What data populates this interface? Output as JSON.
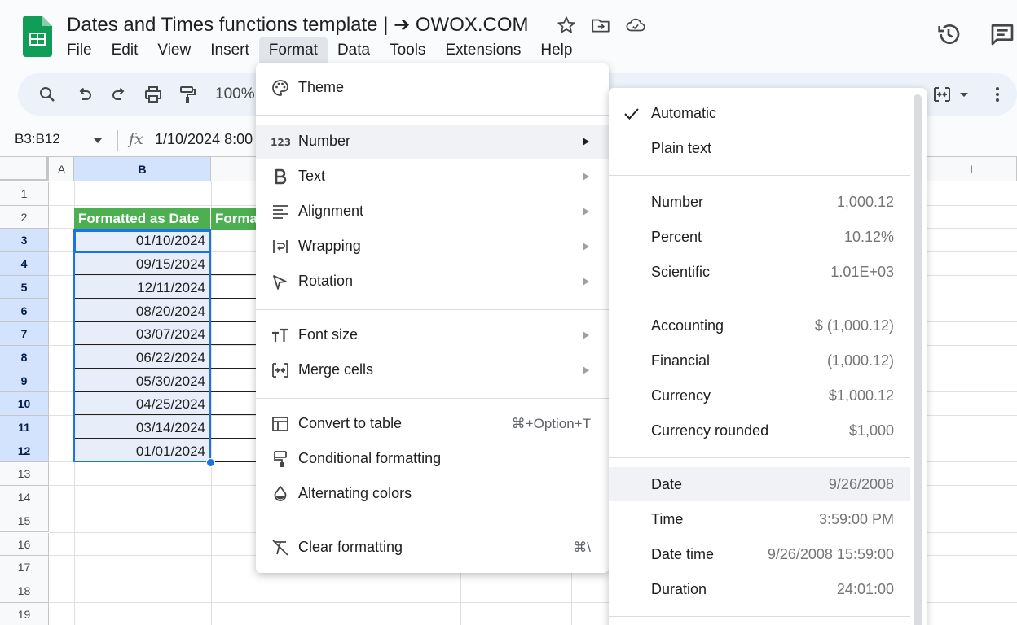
{
  "header": {
    "title": "Dates and Times functions template | ➔ OWOX.COM",
    "menus": [
      "File",
      "Edit",
      "View",
      "Insert",
      "Format",
      "Data",
      "Tools",
      "Extensions",
      "Help"
    ]
  },
  "toolbar": {
    "zoom": "100%"
  },
  "formula_bar": {
    "name_box": "B3:B12",
    "value": "1/10/2024 8:00"
  },
  "grid": {
    "columns": [
      "A",
      "B",
      "I"
    ],
    "rows": [
      "1",
      "2",
      "3",
      "4",
      "5",
      "6",
      "7",
      "8",
      "9",
      "10",
      "11",
      "12",
      "13",
      "14",
      "15",
      "16",
      "17",
      "18",
      "19"
    ],
    "header_cells": [
      "Formatted as Date",
      "Formatted as Date time"
    ],
    "dates": [
      "01/10/2024",
      "09/15/2024",
      "12/11/2024",
      "08/20/2024",
      "03/07/2024",
      "06/22/2024",
      "05/30/2024",
      "04/25/2024",
      "03/14/2024",
      "01/01/2024"
    ]
  },
  "format_menu": {
    "items": [
      {
        "label": "Theme"
      },
      {
        "label": "Number"
      },
      {
        "label": "Text"
      },
      {
        "label": "Alignment"
      },
      {
        "label": "Wrapping"
      },
      {
        "label": "Rotation"
      },
      {
        "label": "Font size"
      },
      {
        "label": "Merge cells"
      },
      {
        "label": "Convert to table",
        "shortcut": "⌘+Option+T"
      },
      {
        "label": "Conditional formatting"
      },
      {
        "label": "Alternating colors"
      },
      {
        "label": "Clear formatting",
        "shortcut": "⌘\\"
      }
    ]
  },
  "number_menu": {
    "items": [
      {
        "label": "Automatic",
        "example": ""
      },
      {
        "label": "Plain text",
        "example": ""
      },
      {
        "label": "Number",
        "example": "1,000.12"
      },
      {
        "label": "Percent",
        "example": "10.12%"
      },
      {
        "label": "Scientific",
        "example": "1.01E+03"
      },
      {
        "label": "Accounting",
        "example": "$ (1,000.12)"
      },
      {
        "label": "Financial",
        "example": "(1,000.12)"
      },
      {
        "label": "Currency",
        "example": "$1,000.12"
      },
      {
        "label": "Currency rounded",
        "example": "$1,000"
      },
      {
        "label": "Date",
        "example": "9/26/2008"
      },
      {
        "label": "Time",
        "example": "3:59:00 PM"
      },
      {
        "label": "Date time",
        "example": "9/26/2008 15:59:00"
      },
      {
        "label": "Duration",
        "example": "24:01:00"
      }
    ]
  },
  "colors": {
    "accent": "#1a73e8",
    "header_fill": "#4caf50",
    "selection": "#d3e3fd",
    "logo": "#0f9d58"
  }
}
